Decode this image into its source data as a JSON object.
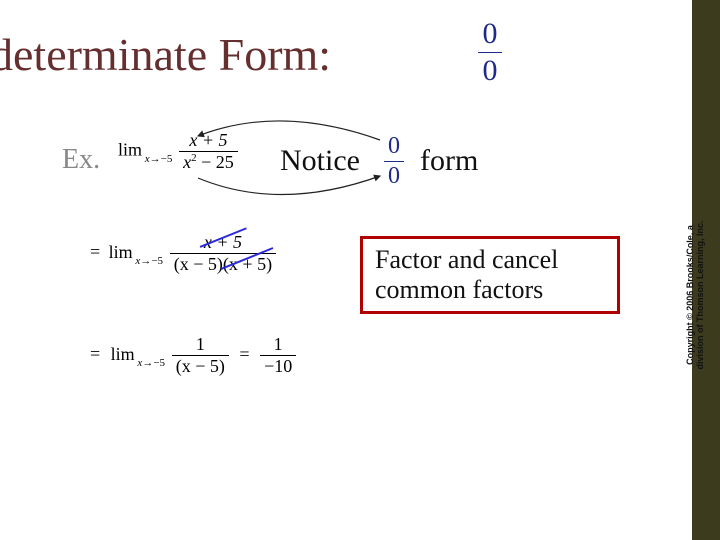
{
  "title": "determinate Form:",
  "title_frac": {
    "num": "0",
    "den": "0"
  },
  "ex_label": "Ex.",
  "notice_label": "Notice",
  "form_label": "form",
  "notice_frac": {
    "num": "0",
    "den": "0"
  },
  "limit1": {
    "lim": "lim",
    "sub_var": "x",
    "sub_arrow": "→",
    "sub_val": "−5",
    "num": "x + 5",
    "den_left": "x",
    "den_sup": "2",
    "den_right": " − 25"
  },
  "eq2": {
    "eq": "=",
    "lim": "lim",
    "sub_var": "x",
    "sub_arrow": "→",
    "sub_val": "−5",
    "num_cancel": "x + 5",
    "den_a": "(x − 5)",
    "den_b_cancel": "(x + 5)"
  },
  "eq3": {
    "eq1": "=",
    "lim": "lim",
    "sub_var": "x",
    "sub_arrow": "→",
    "sub_val": "−5",
    "num": "1",
    "den": "(x − 5)",
    "eq2": "=",
    "num2": "1",
    "den2": "−10"
  },
  "callout": "Factor and cancel common factors",
  "copyright": "Copyright © 2006 Brooks/Cole, a division of Thomson Learning, Inc."
}
